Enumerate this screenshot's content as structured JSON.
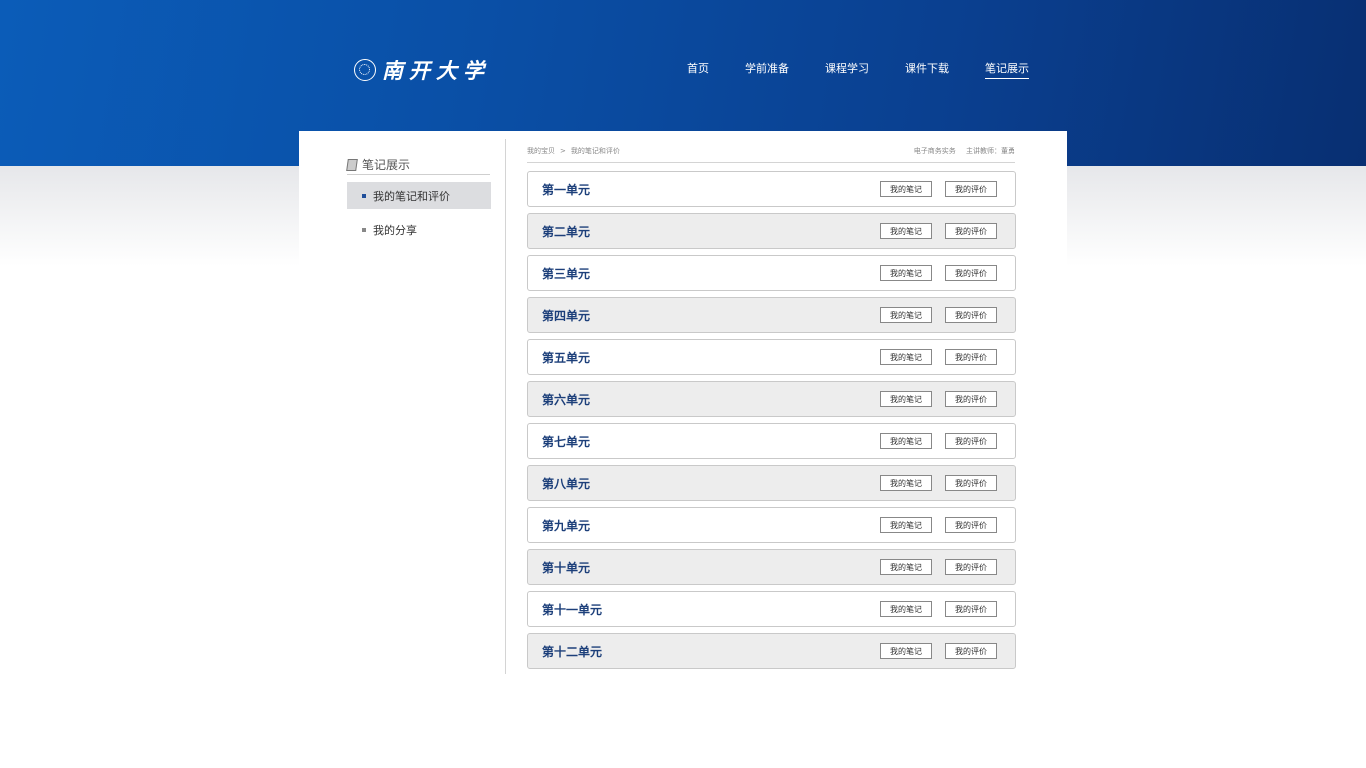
{
  "header": {
    "logo_text": "南开大学",
    "nav": [
      "首页",
      "学前准备",
      "课程学习",
      "课件下载",
      "笔记展示"
    ],
    "nav_active_index": 4
  },
  "sidebar": {
    "title": "笔记展示",
    "items": [
      "我的笔记和评价",
      "我的分享"
    ],
    "active_index": 0
  },
  "breadcrumb": {
    "root": "我的宝贝",
    "separator": ">",
    "current": "我的笔记和评价",
    "course": "电子商务实务",
    "teacher": "主讲教师：董勇"
  },
  "units": [
    {
      "title": "第一单元",
      "notes_label": "我的笔记",
      "review_label": "我的评价"
    },
    {
      "title": "第二单元",
      "notes_label": "我的笔记",
      "review_label": "我的评价"
    },
    {
      "title": "第三单元",
      "notes_label": "我的笔记",
      "review_label": "我的评价"
    },
    {
      "title": "第四单元",
      "notes_label": "我的笔记",
      "review_label": "我的评价"
    },
    {
      "title": "第五单元",
      "notes_label": "我的笔记",
      "review_label": "我的评价"
    },
    {
      "title": "第六单元",
      "notes_label": "我的笔记",
      "review_label": "我的评价"
    },
    {
      "title": "第七单元",
      "notes_label": "我的笔记",
      "review_label": "我的评价"
    },
    {
      "title": "第八单元",
      "notes_label": "我的笔记",
      "review_label": "我的评价"
    },
    {
      "title": "第九单元",
      "notes_label": "我的笔记",
      "review_label": "我的评价"
    },
    {
      "title": "第十单元",
      "notes_label": "我的笔记",
      "review_label": "我的评价"
    },
    {
      "title": "第十一单元",
      "notes_label": "我的笔记",
      "review_label": "我的评价"
    },
    {
      "title": "第十二单元",
      "notes_label": "我的笔记",
      "review_label": "我的评价"
    }
  ],
  "colors": {
    "header_blue": "#0a4fa6",
    "unit_title": "#1c3f7a",
    "row_alt": "#ededed"
  },
  "icons": {
    "logo": "university-seal-icon",
    "sidebar_title": "book-icon",
    "sidebar_bullet": "square-bullet-icon"
  }
}
